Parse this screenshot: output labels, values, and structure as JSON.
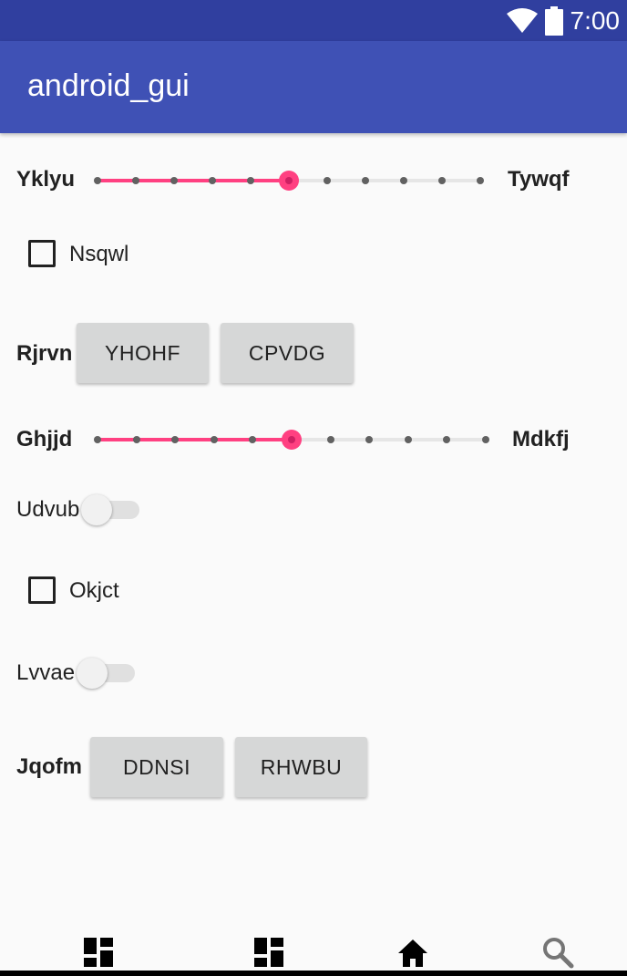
{
  "status_bar": {
    "time": "7:00",
    "icons": [
      "wifi-icon",
      "battery-icon"
    ]
  },
  "app_bar": {
    "title": "android_gui"
  },
  "rows": {
    "seekbar1": {
      "left_label": "Yklyu",
      "right_label": "Tywqf",
      "value": 5,
      "max": 10
    },
    "checkbox1": {
      "label": "Nsqwl",
      "checked": false
    },
    "buttons1": {
      "label": "Rjrvn",
      "button_a": "YHOHF",
      "button_b": "CPVDG"
    },
    "seekbar2": {
      "left_label": "Ghjjd",
      "right_label": "Mdkfj",
      "value": 5,
      "max": 10
    },
    "switch1": {
      "label": "Udvub",
      "on": false
    },
    "checkbox2": {
      "label": "Okjct",
      "checked": false
    },
    "switch2": {
      "label": "Lvvae",
      "on": false
    },
    "buttons2": {
      "label": "Jqofm",
      "button_a": "DDNSI",
      "button_b": "RHWBU"
    }
  },
  "bottom_nav": {
    "items": [
      {
        "icon": "dashboard-icon"
      },
      {
        "icon": "dashboard-icon"
      },
      {
        "icon": "home-icon"
      },
      {
        "icon": "search-icon"
      }
    ]
  },
  "colors": {
    "status_bar": "#303f9f",
    "app_bar": "#3f51b5",
    "accent": "#ff4081",
    "button": "#d6d7d7"
  }
}
